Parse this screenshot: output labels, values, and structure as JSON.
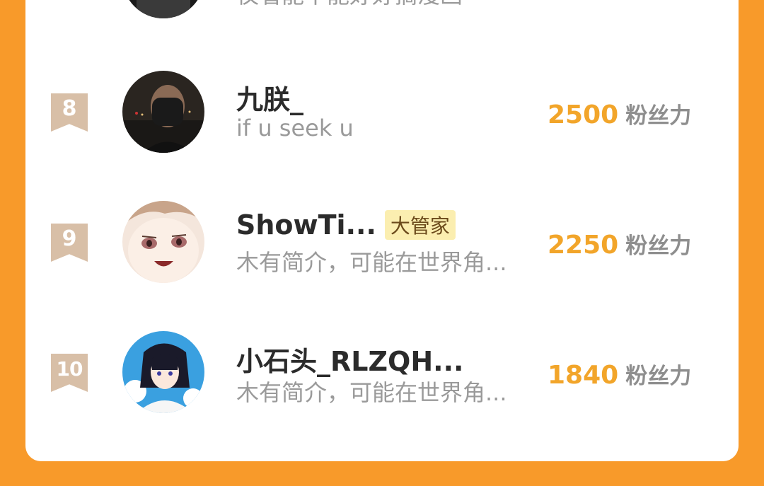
{
  "partial_row": {
    "bio": "仅看能不能好好搞漫画"
  },
  "rows": [
    {
      "rank": "8",
      "name": "九朕_",
      "badge": "",
      "bio": "if u seek u",
      "score": "2500",
      "unit": "粉丝力"
    },
    {
      "rank": "9",
      "name": "ShowTi...",
      "badge": "大管家",
      "bio": "木有简介，可能在世界角...",
      "score": "2250",
      "unit": "粉丝力"
    },
    {
      "rank": "10",
      "name": "小石头_RLZQH...",
      "badge": "",
      "bio": "木有简介，可能在世界角...",
      "score": "1840",
      "unit": "粉丝力"
    }
  ],
  "colors": {
    "background": "#f89a2a",
    "score": "#f2a52a",
    "rank_badge": "#d8bfa7",
    "role_badge": "#fbeeb0"
  }
}
